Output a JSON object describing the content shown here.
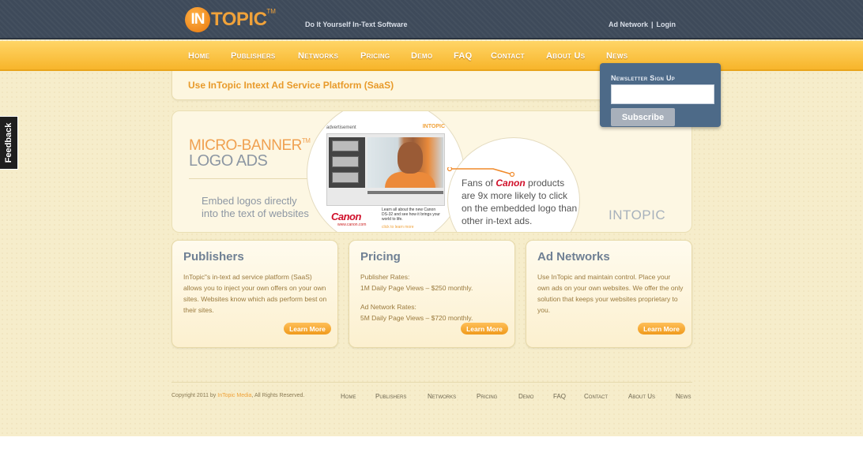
{
  "header": {
    "logo_prefix": "IN",
    "logo_suffix": "TOPIC",
    "logo_tm": "TM",
    "tagline": "Do It Yourself In-Text Software",
    "links": [
      {
        "label": "Ad Network"
      },
      {
        "label": "Login"
      }
    ],
    "link_sep": "|"
  },
  "nav": {
    "items": [
      {
        "label": "Home"
      },
      {
        "label": "Publishers"
      },
      {
        "label": "Networks"
      },
      {
        "label": "Pricing"
      },
      {
        "label": "Demo"
      },
      {
        "label": "FAQ"
      },
      {
        "label": "Contact"
      },
      {
        "label": "About Us"
      },
      {
        "label": "News"
      }
    ]
  },
  "subheader": {
    "title": "Use InTopic Intext Ad Service Platform (SaaS)"
  },
  "newsletter": {
    "title": "Newsletter Sign Up",
    "input_value": "",
    "button_label": "Subscribe"
  },
  "feedback": {
    "label": "Feedback"
  },
  "banner": {
    "headline_1": "MICRO-BANNER",
    "headline_tm": "TM",
    "headline_2": "LOGO ADS",
    "embed_line_1": "Embed logos directly",
    "embed_line_2": "into the text of websites",
    "ad_label": "advertisement",
    "ad_brand": "INTOPIC",
    "ad_canon": "Canon",
    "ad_canon_url": "www.canon.com",
    "ad_copy": "Learn all about the new Canon DS-32 and see how it brings your world to life.",
    "ad_link": "click to learn more",
    "fans_pre": "Fans of ",
    "fans_brand": "Canon",
    "fans_post": " products are 9x more likely to click on the embedded logo than other in-text ads.",
    "watermark": "INTOPIC"
  },
  "cards": [
    {
      "title": "Publishers",
      "paragraphs": [
        "InTopic\"s in-text ad service platform (SaaS) allows you to inject your own offers on your own sites.  Websites know which ads perform best on their sites."
      ],
      "button": "Learn More"
    },
    {
      "title": "Pricing",
      "paragraphs": [
        "Publisher Rates:",
        "1M Daily Page Views – $250 monthly.",
        "Ad Network Rates:",
        "5M Daily Page Views – $720 monthly."
      ],
      "button": "Learn More"
    },
    {
      "title": "Ad Networks",
      "paragraphs": [
        "Use InTopic and maintain control. Place your own ads on your own websites.  We offer the only solution that keeps your websites proprietary to you."
      ],
      "button": "Learn More"
    }
  ],
  "footer": {
    "copyright_pre": "Copyright 2011 by ",
    "copyright_brand": "InTopic Media",
    "copyright_post": ", All Rights Reserved.",
    "links": [
      {
        "label": "Home"
      },
      {
        "label": "Publishers"
      },
      {
        "label": "Networks"
      },
      {
        "label": "Pricing"
      },
      {
        "label": "Demo"
      },
      {
        "label": "FAQ"
      },
      {
        "label": "Contact"
      },
      {
        "label": "About Us"
      },
      {
        "label": "News"
      }
    ]
  },
  "colors": {
    "header_bg": "#3e4a5a",
    "nav_bg": "#f7b52b",
    "accent_orange": "#f0a23a",
    "card_title": "#6f8094",
    "newsletter_bg": "#4d6a88"
  }
}
